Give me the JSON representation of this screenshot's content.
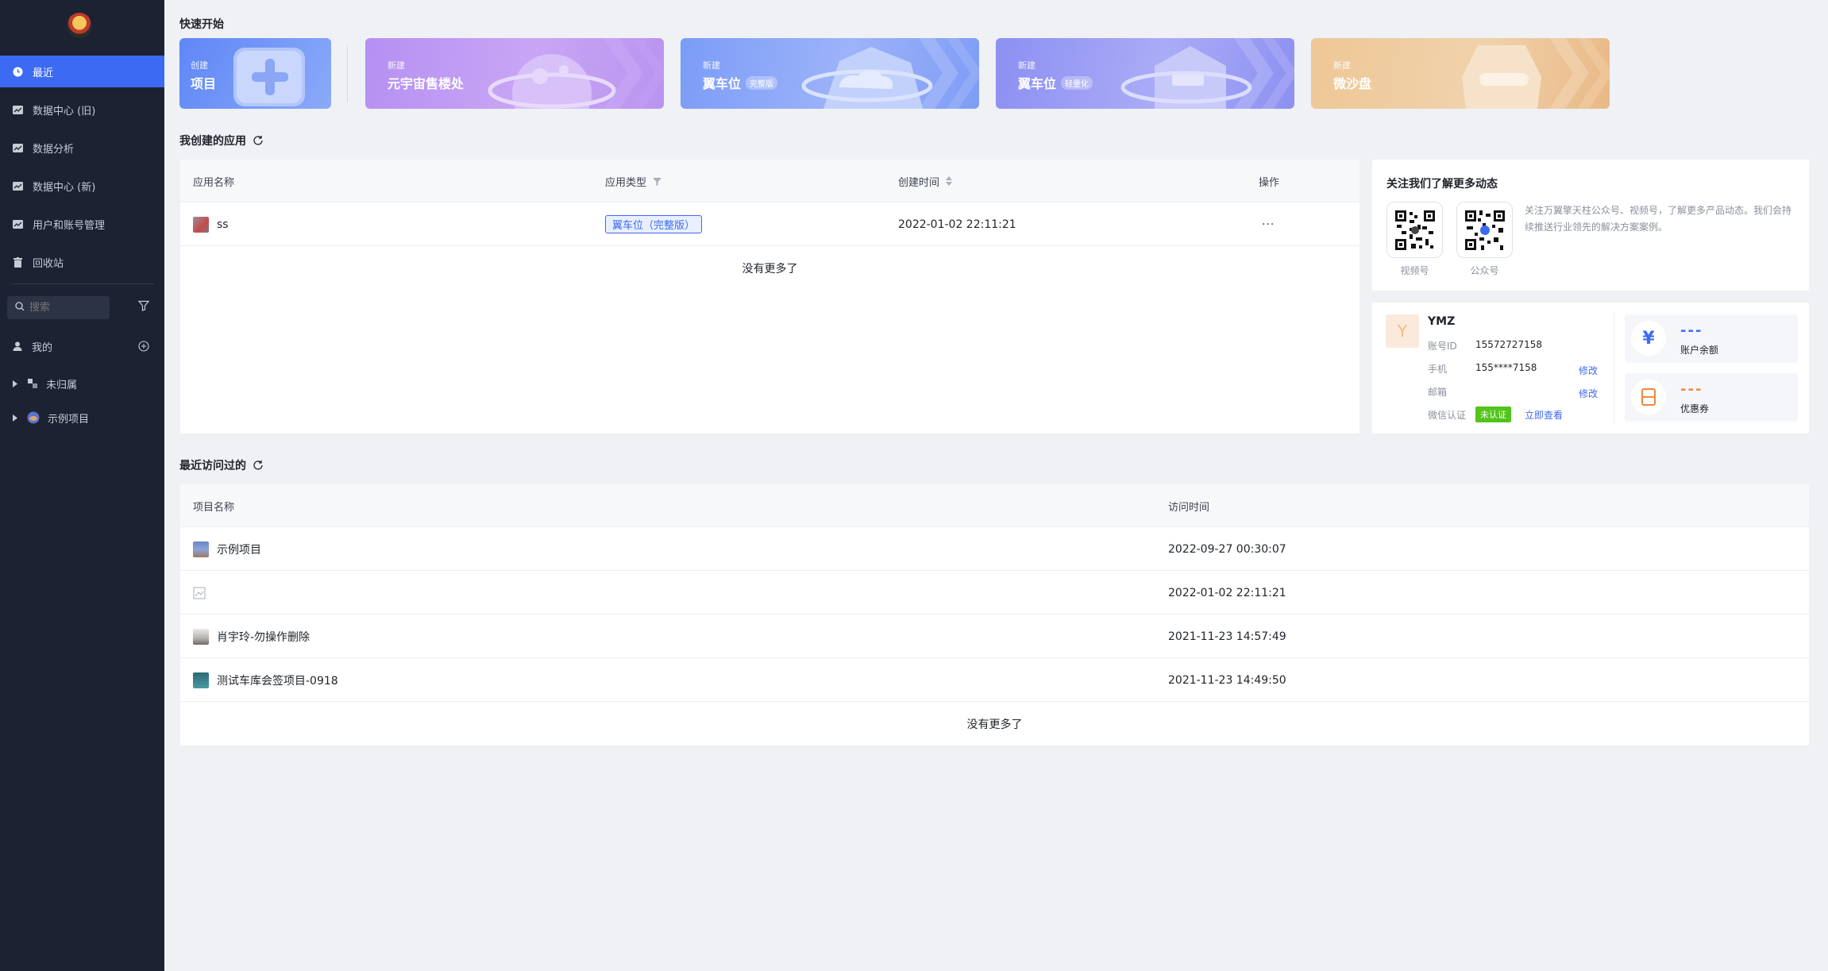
{
  "sidebar": {
    "nav": [
      {
        "label": "最近",
        "icon": "clock-icon",
        "active": true
      },
      {
        "label": "数据中心 (旧)",
        "icon": "chart-icon",
        "active": false
      },
      {
        "label": "数据分析",
        "icon": "chart-icon",
        "active": false
      },
      {
        "label": "数据中心 (新)",
        "icon": "chart-icon",
        "active": false
      },
      {
        "label": "用户和账号管理",
        "icon": "chart-icon",
        "active": false
      },
      {
        "label": "回收站",
        "icon": "trash-icon",
        "active": false
      }
    ],
    "search_placeholder": "搜索",
    "tree": {
      "mine": "我的",
      "items": [
        {
          "label": "未归属",
          "icon": "tree-icon"
        },
        {
          "label": "示例项目",
          "icon": "globe-icon"
        }
      ]
    }
  },
  "quick_start": {
    "title": "快速开始",
    "cards": [
      {
        "small": "创建",
        "big": "项目",
        "tag": ""
      },
      {
        "small": "新建",
        "big": "元宇宙售楼处",
        "tag": ""
      },
      {
        "small": "新建",
        "big": "翼车位",
        "tag": "完整版"
      },
      {
        "small": "新建",
        "big": "翼车位",
        "tag": "轻量化"
      },
      {
        "small": "新建",
        "big": "微沙盘",
        "tag": ""
      }
    ]
  },
  "my_apps": {
    "title": "我创建的应用",
    "columns": [
      "应用名称",
      "应用类型",
      "创建时间",
      "操作"
    ],
    "rows": [
      {
        "name": "ss",
        "type": "翼车位（完整版）",
        "created": "2022-01-02 22:11:21",
        "action": "···"
      }
    ],
    "no_more": "没有更多了"
  },
  "follow": {
    "title": "关注我们了解更多动态",
    "desc": "关注万翼擎天柱公众号、视频号，了解更多产品动态。我们会持续推送行业领先的解决方案案例。",
    "qr_labels": [
      "视频号",
      "公众号"
    ]
  },
  "account": {
    "avatar_letter": "Y",
    "name": "YMZ",
    "fields": {
      "id_label": "账号ID",
      "id_value": "15572727158",
      "phone_label": "手机",
      "phone_value": "155****7158",
      "email_label": "邮箱",
      "email_value": "",
      "wechat_label": "微信认证",
      "wechat_status": "未认证",
      "wechat_link": "立即查看"
    },
    "edit_label": "修改",
    "balance": {
      "value": "---",
      "label": "账户余额",
      "icon": "yuan-icon"
    },
    "coupon": {
      "value": "---",
      "label": "优惠券",
      "icon": "coupon-icon"
    }
  },
  "recent": {
    "title": "最近访问过的",
    "columns": [
      "项目名称",
      "访问时间"
    ],
    "rows": [
      {
        "name": "示例项目",
        "time": "2022-09-27 00:30:07"
      },
      {
        "name": "",
        "time": "2022-01-02 22:11:21"
      },
      {
        "name": "肖宇玲-勿操作删除",
        "time": "2021-11-23 14:57:49"
      },
      {
        "name": "测试车库会签项目-0918",
        "time": "2021-11-23 14:49:50"
      }
    ],
    "no_more": "没有更多了"
  },
  "colors": {
    "primary": "#3d6af2",
    "sidebar": "#1c2231",
    "success": "#52c41a",
    "orange": "#f0883e"
  }
}
